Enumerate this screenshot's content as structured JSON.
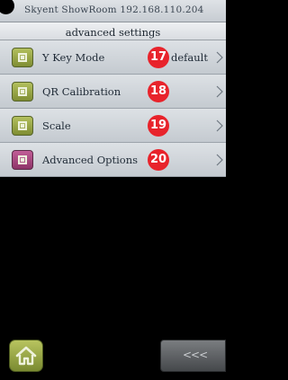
{
  "status_bar": {
    "text": "Skyent ShowRoom 192.168.110.204"
  },
  "title_bar": {
    "title": "advanced settings"
  },
  "menu": {
    "items": [
      {
        "label": "Y Key Mode",
        "badge": "17",
        "value": "default",
        "icon": "square-target-icon",
        "icon_color": "#9aa84a"
      },
      {
        "label": "QR Calibration",
        "badge": "18",
        "value": "",
        "icon": "square-target-icon",
        "icon_color": "#9aa84a"
      },
      {
        "label": "Scale",
        "badge": "19",
        "value": "",
        "icon": "square-target-icon",
        "icon_color": "#9aa84a"
      },
      {
        "label": "Advanced Options",
        "badge": "20",
        "value": "",
        "icon": "square-target-icon",
        "icon_color": "#a84a80"
      }
    ]
  },
  "bottom_bar": {
    "home_icon": "home-icon",
    "back_label": "<<<"
  },
  "colors": {
    "badge": "#e8232b",
    "menu_bg": "#d3d8dd",
    "icon_green": "#9aa84a",
    "icon_purple": "#a84a80"
  }
}
